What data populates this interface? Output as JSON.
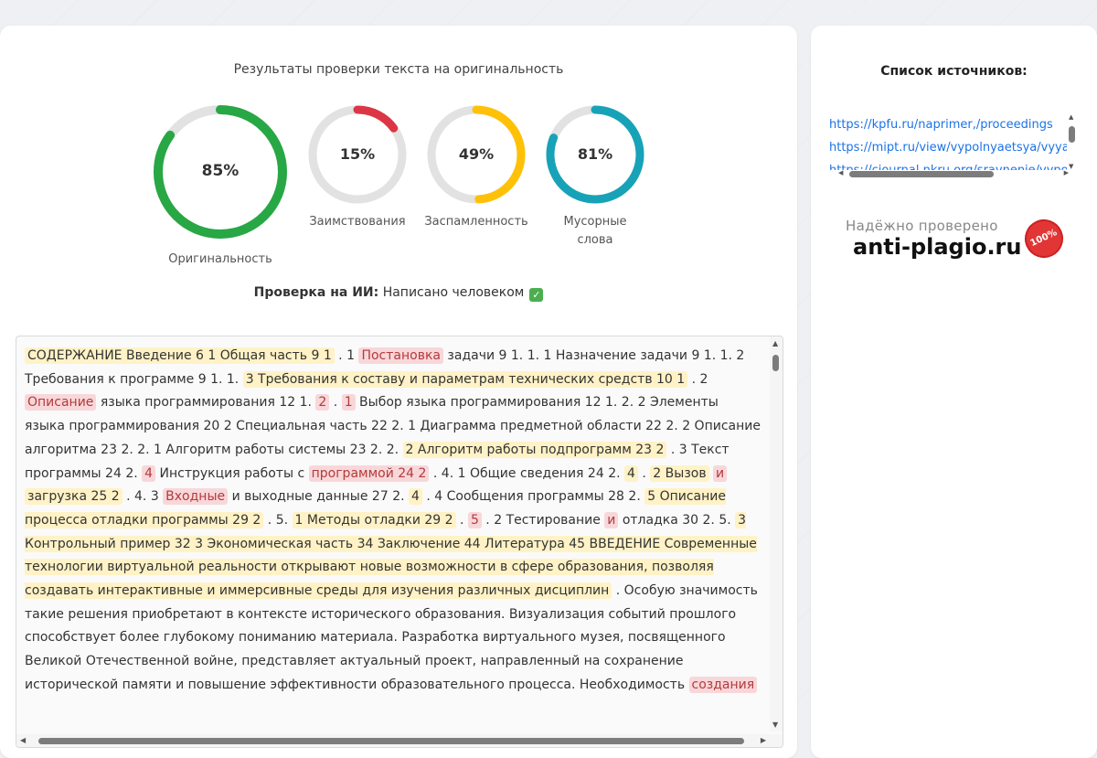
{
  "results": {
    "title": "Результаты проверки текста на оригинальность",
    "gauges": [
      {
        "id": "originality",
        "value": 85,
        "display": "85%",
        "label": "Оригинальность",
        "color": "#28a745"
      },
      {
        "id": "borrowings",
        "value": 15,
        "display": "15%",
        "label": "Заимствования",
        "color": "#dc3545"
      },
      {
        "id": "spam",
        "value": 49,
        "display": "49%",
        "label": "Заспамленность",
        "color": "#ffc107"
      },
      {
        "id": "junk",
        "value": 81,
        "display": "81%",
        "label": "Мусорные слова",
        "color": "#17a2b8"
      }
    ]
  },
  "ai_check": {
    "label": "Проверка на ИИ:",
    "value": "Написано человеком",
    "icon": "check-mark-icon"
  },
  "document_text": [
    {
      "t": "СОДЕРЖАНИЕ Введение 6 1 Общая часть 9 1",
      "h": "y"
    },
    {
      "t": " . 1 "
    },
    {
      "t": "Постановка",
      "h": "r"
    },
    {
      "t": " задачи 9 1. 1. 1 Назначение задачи 9 1. 1. 2 Требования к программе 9 1. 1. "
    },
    {
      "t": "3 Требования к составу и параметрам технических средств 10 1",
      "h": "y"
    },
    {
      "t": " . 2 "
    },
    {
      "t": "Описание",
      "h": "r"
    },
    {
      "t": " языка программирования 12 1. "
    },
    {
      "t": "2",
      "h": "r"
    },
    {
      "t": " . "
    },
    {
      "t": "1",
      "h": "r"
    },
    {
      "t": " Выбор языка программирования 12 1. 2. 2 Элементы языка программирования 20 2 Специальная часть 22 2. 1 Диаграмма предметной области 22 2. 2 Описание алгоритма 23 2. 2. 1 Алгоритм работы системы 23 2. 2. "
    },
    {
      "t": "2 Алгоритм работы подпрограмм 23 2",
      "h": "y"
    },
    {
      "t": " . 3 Текст программы 24 2. "
    },
    {
      "t": "4",
      "h": "r"
    },
    {
      "t": " Инструкция работы с "
    },
    {
      "t": "программой 24 2",
      "h": "r"
    },
    {
      "t": " . 4. 1 Общие сведения 24 2. "
    },
    {
      "t": "4",
      "h": "y"
    },
    {
      "t": " . "
    },
    {
      "t": "2 Вызов",
      "h": "y"
    },
    {
      "t": " "
    },
    {
      "t": "и",
      "h": "r"
    },
    {
      "t": " "
    },
    {
      "t": "загрузка 25 2",
      "h": "y"
    },
    {
      "t": " . 4. 3 "
    },
    {
      "t": "Входные",
      "h": "r"
    },
    {
      "t": " и выходные данные 27 2. "
    },
    {
      "t": "4",
      "h": "y"
    },
    {
      "t": " . 4 Сообщения программы 28 2. "
    },
    {
      "t": "5 Описание процесса отладки программы 29 2",
      "h": "y"
    },
    {
      "t": " . 5. "
    },
    {
      "t": "1 Методы отладки 29 2",
      "h": "y"
    },
    {
      "t": " . "
    },
    {
      "t": "5",
      "h": "r"
    },
    {
      "t": " . 2 Тестирование "
    },
    {
      "t": "и",
      "h": "r"
    },
    {
      "t": " отладка 30 2. 5. "
    },
    {
      "t": "3 Контрольный пример 32 3 Экономическая часть 34 Заключение 44 Литература 45 ВВЕДЕНИЕ Современные технологии виртуальной реальности открывают новые возможности в сфере образования, позволяя создавать интерактивные и иммерсивные среды для изучения различных дисциплин",
      "h": "y"
    },
    {
      "t": " . Особую значимость такие решения приобретают в контексте исторического образования. Визуализация событий прошлого способствует более глубокому пониманию материала. Разработка виртуального музея, посвященного Великой Отечественной войне, представляет актуальный проект, направленный на сохранение исторической памяти и повышение эффективности образовательного процесса. Необходимость "
    },
    {
      "t": "создания",
      "h": "r"
    }
  ],
  "sources": {
    "title": "Список источников:",
    "links": [
      "https://kpfu.ru/naprimer,/proceedings",
      "https://mipt.ru/view/vypolnyaetsya/vyyavleniya",
      "https://cjournal.nkru.org/sravnenie/vypolnyaetsya"
    ]
  },
  "badge": {
    "top": "Надёжно проверено",
    "main": "anti-plagio.ru",
    "seal": "100%"
  }
}
